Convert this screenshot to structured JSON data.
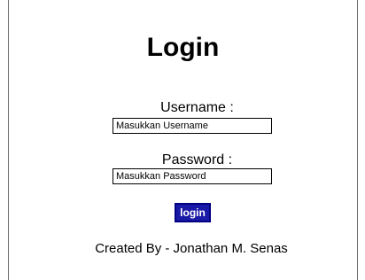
{
  "title": "Login",
  "form": {
    "username_label": "Username :",
    "username_placeholder": "Masukkan Username",
    "password_label": "Password :",
    "password_placeholder": "Masukkan Password",
    "submit_label": "login"
  },
  "footer": {
    "credit": "Created By - Jonathan M. Senas"
  },
  "colors": {
    "button_background": "#1a1aa8",
    "button_text": "#ffffff",
    "frame_border": "#6e6e6e"
  }
}
